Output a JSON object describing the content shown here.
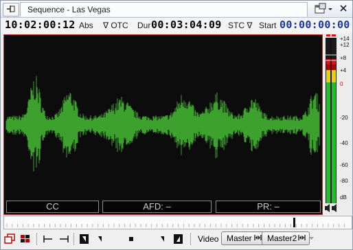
{
  "window": {
    "title": "Sequence - Las Vegas"
  },
  "timecode": {
    "abs_value": "10:02:00:12",
    "abs_label": "Abs",
    "otc_label": "∇ OTC",
    "dur_label": "Dur",
    "dur_value": "00:03:04:09",
    "stc_label": "STC ∇",
    "start_label": "Start",
    "start_value": "00:00:00:00"
  },
  "status_bar": {
    "cc": "CC",
    "afd": "AFD: –",
    "pr": "PR: –"
  },
  "meter": {
    "ticks": [
      "+14",
      "+12",
      "+8",
      "+4",
      "0",
      "-20",
      "-40",
      "-60",
      "-80",
      "dB"
    ]
  },
  "toolbar": {
    "video_label": "Video",
    "master_label": "Master",
    "master2_label": "Master2"
  },
  "colors": {
    "waveform": "#3da12e",
    "monitor_border": "#b43a3a",
    "timecode_blue": "#1636a0",
    "meter_green": "#1fbf2a",
    "meter_yellow": "#e8d200",
    "meter_red": "#e01010"
  },
  "icons": {
    "pin": "pin-icon",
    "window_menu": "window-menu-icon",
    "close": "close-icon",
    "speaker": "speaker-icon",
    "play": "play-icon",
    "stop": "stop-icon"
  }
}
